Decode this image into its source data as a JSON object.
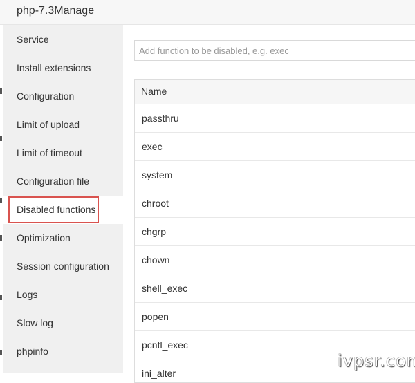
{
  "window": {
    "title": "php-7.3Manage"
  },
  "sidebar": {
    "items": [
      {
        "label": "Service"
      },
      {
        "label": "Install extensions"
      },
      {
        "label": "Configuration"
      },
      {
        "label": "Limit of upload"
      },
      {
        "label": "Limit of timeout"
      },
      {
        "label": "Configuration file"
      },
      {
        "label": "Disabled functions",
        "active": true
      },
      {
        "label": "Optimization"
      },
      {
        "label": "Session configuration"
      },
      {
        "label": "Logs"
      },
      {
        "label": "Slow log"
      },
      {
        "label": "phpinfo"
      }
    ]
  },
  "main": {
    "input": {
      "placeholder": "Add function to be disabled, e.g. exec",
      "value": ""
    },
    "table": {
      "columns": [
        "Name"
      ],
      "rows": [
        {
          "name": "passthru"
        },
        {
          "name": "exec"
        },
        {
          "name": "system"
        },
        {
          "name": "chroot"
        },
        {
          "name": "chgrp"
        },
        {
          "name": "chown"
        },
        {
          "name": "shell_exec"
        },
        {
          "name": "popen"
        },
        {
          "name": "pcntl_exec"
        },
        {
          "name": "ini_alter"
        }
      ]
    }
  },
  "watermark": {
    "text": "ivpsr.com"
  },
  "colors": {
    "highlight": "#d9534f",
    "sidebar_bg": "#f0f0f0",
    "active_bg": "#ffffff"
  }
}
